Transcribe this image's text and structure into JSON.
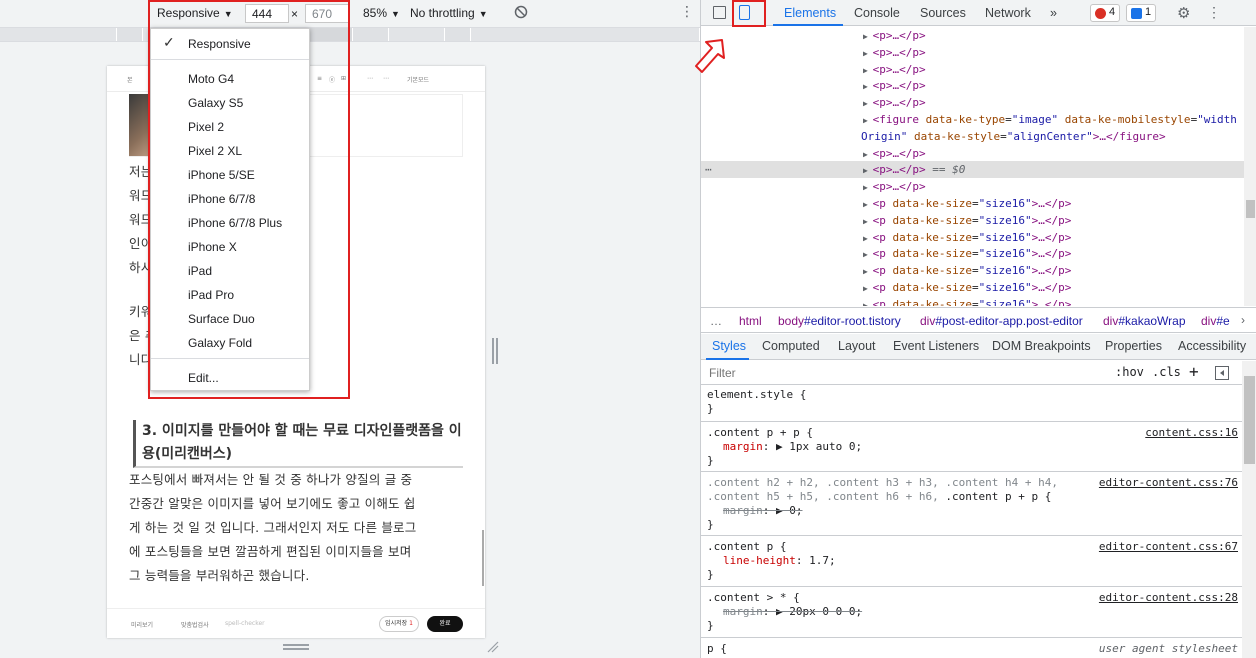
{
  "toolbar": {
    "device": "Responsive",
    "width": "444",
    "times": "×",
    "height": "670",
    "zoom": "85%",
    "throttling": "No throttling"
  },
  "device_menu": {
    "selected": "Responsive",
    "devices": [
      "Moto G4",
      "Galaxy S5",
      "Pixel 2",
      "Pixel 2 XL",
      "iPhone 5/SE",
      "iPhone 6/7/8",
      "iPhone 6/7/8 Plus",
      "iPhone X",
      "iPad",
      "iPad Pro",
      "Surface Duo",
      "Galaxy Fold"
    ],
    "edit": "Edit..."
  },
  "page": {
    "topbar": [
      "본",
      "≡",
      "ⓔ",
      "⊞",
      "⋯",
      "⋯",
      "기본모드"
    ],
    "para1_lines": [
      "저는 중에서는 블랙키위나 키",
      "워드 서 검색량을 조회하고 키",
      "워드 사이트가 좋다 보다는 본",
      "인이 고 편안한 사이트를 이용",
      "하시"
    ],
    "para2_lines": [
      "키워 이트에 대한 자세한 설명",
      "은 추 자세히 다뤄보도록 하겠습",
      "니다"
    ],
    "heading": "3. 이미지를 만들어야 할 때는 무료 디자인플랫폼을 이용(미리캔버스)",
    "para3_lines": [
      "포스팅에서 빠져서는 안 될 것 중 하나가 양질의 글 중",
      "간중간 알맞은 이미지를 넣어 보기에도 좋고 이해도 쉽",
      "게 하는 것 일 것 입니다. 그래서인지 저도 다른 블로그",
      "에 포스팅들을 보면 깔끔하게 편집된 이미지들을 보며",
      "그 능력들을 부러워하곤 했습니다."
    ],
    "footer_left": [
      "미리보기",
      "맞춤법검사",
      "spell-checker"
    ],
    "temp_save": "임시저장",
    "temp_count": "1",
    "publish": "완료"
  },
  "devtools": {
    "tabs": [
      "Elements",
      "Console",
      "Sources",
      "Network",
      "»"
    ],
    "errors": "4",
    "messages": "1",
    "dom_lines": [
      {
        "indent": 160,
        "tri": "▶",
        "html": "<p>…</p>"
      },
      {
        "indent": 160,
        "tri": "▶",
        "html": "<p>…</p>"
      },
      {
        "indent": 160,
        "tri": "▶",
        "html": "<p>…</p>"
      },
      {
        "indent": 160,
        "tri": "▶",
        "html": "<p>…</p>"
      },
      {
        "indent": 160,
        "tri": "▶",
        "html": "<p>…</p>"
      },
      {
        "indent": 160,
        "tri": "▶",
        "tag_open": "<figure",
        "attrs": [
          [
            "data-ke-type",
            "\"image\""
          ],
          [
            "data-ke-mobilestyle",
            "\"width"
          ]
        ]
      },
      {
        "indent": 160,
        "tri": "",
        "cont": "Origin\"",
        "attrs": [
          [
            "data-ke-style",
            "\"alignCenter\""
          ]
        ],
        "tail": ">…</figure>"
      },
      {
        "indent": 160,
        "tri": "▶",
        "html": "<p>…</p>"
      },
      {
        "indent": 160,
        "tri": "▶",
        "html": "<p>…</p>",
        "selected": true,
        "eq": "== $0"
      },
      {
        "indent": 160,
        "tri": "▶",
        "html": "<p>…</p>"
      },
      {
        "indent": 160,
        "tri": "▶",
        "tag_open": "<p",
        "attrs": [
          [
            "data-ke-size",
            "\"size16\""
          ]
        ],
        "tail": ">…</p>"
      },
      {
        "indent": 160,
        "tri": "▶",
        "tag_open": "<p",
        "attrs": [
          [
            "data-ke-size",
            "\"size16\""
          ]
        ],
        "tail": ">…</p>"
      },
      {
        "indent": 160,
        "tri": "▶",
        "tag_open": "<p",
        "attrs": [
          [
            "data-ke-size",
            "\"size16\""
          ]
        ],
        "tail": ">…</p>"
      },
      {
        "indent": 160,
        "tri": "▶",
        "tag_open": "<p",
        "attrs": [
          [
            "data-ke-size",
            "\"size16\""
          ]
        ],
        "tail": ">…</p>"
      },
      {
        "indent": 160,
        "tri": "▶",
        "tag_open": "<p",
        "attrs": [
          [
            "data-ke-size",
            "\"size16\""
          ]
        ],
        "tail": ">…</p>"
      },
      {
        "indent": 160,
        "tri": "▶",
        "tag_open": "<p",
        "attrs": [
          [
            "data-ke-size",
            "\"size16\""
          ]
        ],
        "tail": ">…</p>"
      },
      {
        "indent": 160,
        "tri": "▶",
        "tag_open": "<p",
        "attrs": [
          [
            "data-ke-size",
            "\"size16\""
          ]
        ],
        "tail": ">…</p>"
      }
    ],
    "dots_label": "…",
    "breadcrumbs": [
      {
        "tag": "html",
        "rest": ""
      },
      {
        "tag": "body",
        "rest": "#editor-root.tistory"
      },
      {
        "tag": "div",
        "rest": "#post-editor-app.post-editor"
      },
      {
        "tag": "div",
        "rest": "#kakaoWrap"
      },
      {
        "tag": "div",
        "rest": "#e"
      }
    ],
    "side_tabs": [
      "Styles",
      "Computed",
      "Layout",
      "Event Listeners",
      "DOM Breakpoints",
      "Properties",
      "Accessibility"
    ],
    "filter_placeholder": "Filter",
    "hov": ":hov",
    "cls": ".cls",
    "rules": [
      {
        "selector": "element.style {",
        "source": "",
        "props": [],
        "close": "}"
      },
      {
        "selector": ".content p + p {",
        "source": "content.css:16",
        "props": [
          {
            "name": "margin",
            "value": "▶ 1px auto 0;",
            "struck": false
          }
        ],
        "close": "}"
      },
      {
        "selector": ".content h2 + h2, .content h3 + h3, .content h4 + h4,",
        "selector2": ".content h5 + h5, .content h6 + h6, .content p + p {",
        "source": "editor-content.css:76",
        "props": [
          {
            "name": "margin",
            "value": "▶ 0;",
            "struck": true
          }
        ],
        "close": "}"
      },
      {
        "selector": ".content p {",
        "source": "editor-content.css:67",
        "props": [
          {
            "name": "line-height",
            "value": "1.7;",
            "struck": false
          }
        ],
        "close": "}"
      },
      {
        "selector": ".content > * {",
        "source": "editor-content.css:28",
        "props": [
          {
            "name": "margin",
            "value": "▶ 20px 0 0 0;",
            "struck": true
          }
        ],
        "close": "}"
      },
      {
        "selector": "p {",
        "source": "user agent stylesheet",
        "props": [],
        "close": ""
      }
    ]
  },
  "colors": {
    "highlight_box": "#e02020",
    "accent": "#1a73e8"
  }
}
